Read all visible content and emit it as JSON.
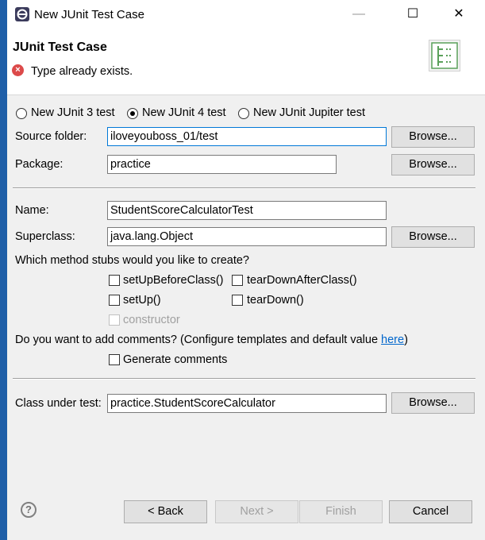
{
  "window": {
    "title": "New JUnit Test Case",
    "minimize_icon": "—",
    "maximize_icon": "☐",
    "close_icon": "✕"
  },
  "header": {
    "title": "JUnit Test Case",
    "message": "Type already exists.",
    "message_icon": "×"
  },
  "junit_versions": {
    "options": [
      "New JUnit 3 test",
      "New JUnit 4 test",
      "New JUnit Jupiter test"
    ],
    "selected": "New JUnit 4 test"
  },
  "fields": {
    "source_folder": {
      "label": "Source folder:",
      "value": "iloveyouboss_01/test"
    },
    "package": {
      "label": "Package:",
      "value": "practice"
    },
    "name": {
      "label": "Name:",
      "value": "StudentScoreCalculatorTest"
    },
    "superclass": {
      "label": "Superclass:",
      "value": "java.lang.Object"
    },
    "class_under_test": {
      "label": "Class under test:",
      "value": "practice.StudentScoreCalculator"
    }
  },
  "browse_label": "Browse...",
  "stubs": {
    "question": "Which method stubs would you like to create?",
    "setUpBeforeClass": "setUpBeforeClass()",
    "tearDownAfterClass": "tearDownAfterClass()",
    "setUp": "setUp()",
    "tearDown": "tearDown()",
    "constructor": "constructor"
  },
  "comments": {
    "question_prefix": "Do you want to add comments? (Configure templates and default value ",
    "link": "here",
    "question_suffix": ")",
    "generate": "Generate comments"
  },
  "footer": {
    "help_icon": "?",
    "back": "< Back",
    "next": "Next >",
    "finish": "Finish",
    "cancel": "Cancel"
  }
}
